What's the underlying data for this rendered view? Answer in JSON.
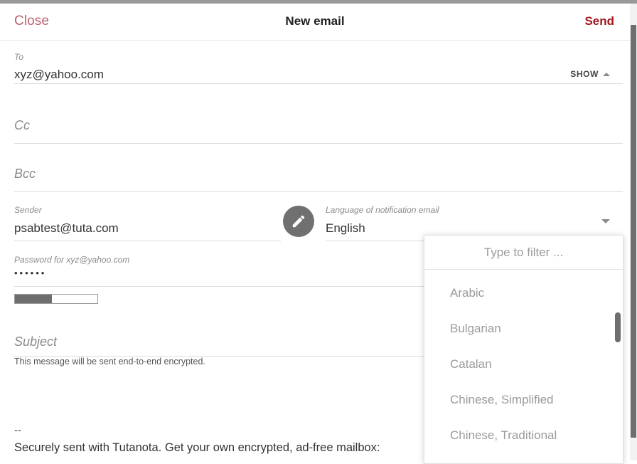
{
  "header": {
    "close_label": "Close",
    "title": "New email",
    "send_label": "Send"
  },
  "recipients": {
    "to": {
      "label": "To",
      "value": "xyz@yahoo.com"
    },
    "show_button": {
      "label": "SHOW",
      "icon": "caret-up-icon"
    },
    "cc": {
      "label": "Cc",
      "value": ""
    },
    "bcc": {
      "label": "Bcc",
      "value": ""
    }
  },
  "sender": {
    "label": "Sender",
    "value": "psabtest@tuta.com",
    "edit_icon": "pencil-icon"
  },
  "language": {
    "label": "Language of notification email",
    "value": "English",
    "caret_icon": "caret-down-icon"
  },
  "password": {
    "label": "Password for xyz@yahoo.com",
    "value": "••••••",
    "strength_percent": 45
  },
  "subject": {
    "label": "Subject",
    "value": ""
  },
  "encryption_note": "This message will be sent end-to-end encrypted.",
  "body": {
    "separator": "--",
    "signature": "Securely sent with Tutanota. Get your own encrypted, ad-free mailbox:"
  },
  "dropdown": {
    "filter_placeholder": "Type to filter ...",
    "filter_value": "",
    "items": [
      {
        "label": "Arabic"
      },
      {
        "label": "Bulgarian"
      },
      {
        "label": "Catalan"
      },
      {
        "label": "Chinese, Simplified"
      },
      {
        "label": "Chinese, Traditional"
      }
    ]
  },
  "colors": {
    "close_red": "#b9616c",
    "send_red": "#a3161d",
    "label_gray": "#8a8a8a",
    "item_gray": "#9a9a9a",
    "strength_fill": "#6e6e6e"
  }
}
